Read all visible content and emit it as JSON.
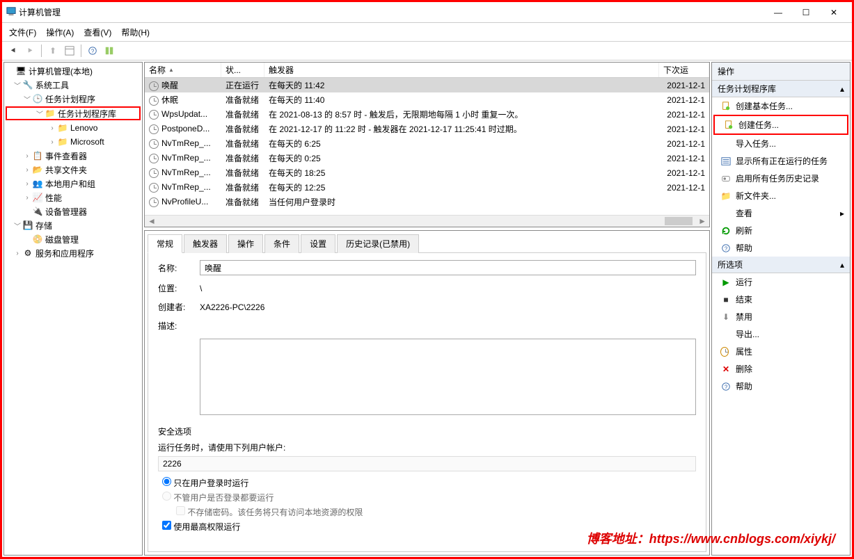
{
  "window": {
    "title": "计算机管理"
  },
  "menu": {
    "file": "文件(F)",
    "action": "操作(A)",
    "view": "查看(V)",
    "help": "帮助(H)"
  },
  "tree": {
    "root": "计算机管理(本地)",
    "systools": "系统工具",
    "tasksched": "任务计划程序",
    "taskslib": "任务计划程序库",
    "lenovo": "Lenovo",
    "microsoft": "Microsoft",
    "eventviewer": "事件查看器",
    "shared": "共享文件夹",
    "users": "本地用户和组",
    "perf": "性能",
    "devmgr": "设备管理器",
    "storage": "存储",
    "diskmgmt": "磁盘管理",
    "services": "服务和应用程序"
  },
  "list": {
    "headers": {
      "name": "名称",
      "status": "状...",
      "trigger": "触发器",
      "next": "下次运"
    },
    "rows": [
      {
        "name": "唤醒",
        "status": "正在运行",
        "trigger": "在每天的 11:42",
        "next": "2021-12-1",
        "selected": true
      },
      {
        "name": "休眠",
        "status": "准备就绪",
        "trigger": "在每天的 11:40",
        "next": "2021-12-1"
      },
      {
        "name": "WpsUpdat...",
        "status": "准备就绪",
        "trigger": "在 2021-08-13 的 8:57 时 - 触发后，无限期地每隔 1 小时 重复一次。",
        "next": "2021-12-1"
      },
      {
        "name": "PostponeD...",
        "status": "准备就绪",
        "trigger": "在 2021-12-17 的 11:22 时 - 触发器在 2021-12-17 11:25:41 时过期。",
        "next": "2021-12-1"
      },
      {
        "name": "NvTmRep_...",
        "status": "准备就绪",
        "trigger": "在每天的 6:25",
        "next": "2021-12-1"
      },
      {
        "name": "NvTmRep_...",
        "status": "准备就绪",
        "trigger": "在每天的 0:25",
        "next": "2021-12-1"
      },
      {
        "name": "NvTmRep_...",
        "status": "准备就绪",
        "trigger": "在每天的 18:25",
        "next": "2021-12-1"
      },
      {
        "name": "NvTmRep_...",
        "status": "准备就绪",
        "trigger": "在每天的 12:25",
        "next": "2021-12-1"
      },
      {
        "name": "NvProfileU...",
        "status": "准备就绪",
        "trigger": "当任何用户登录时",
        "next": ""
      }
    ]
  },
  "tabs": {
    "general": "常规",
    "triggers": "触发器",
    "actions": "操作",
    "conditions": "条件",
    "settings": "设置",
    "history": "历史记录(已禁用)"
  },
  "detail": {
    "name_label": "名称:",
    "name_value": "唤醒",
    "loc_label": "位置:",
    "loc_value": "\\",
    "author_label": "创建者:",
    "author_value": "XA2226-PC\\2226",
    "desc_label": "描述:",
    "sec_legend": "安全选项",
    "sec_useracc_label": "运行任务时，请使用下列用户帐户:",
    "sec_useracc": "2226",
    "sec_radio1": "只在用户登录时运行",
    "sec_radio2": "不管用户是否登录都要运行",
    "sec_chk1": "不存储密码。该任务将只有访问本地资源的权限",
    "sec_chk2": "使用最高权限运行"
  },
  "actionsPane": {
    "header": "操作",
    "group1": "任务计划程序库",
    "items1": [
      {
        "icon": "doc-new",
        "label": "创建基本任务..."
      },
      {
        "icon": "doc-new",
        "label": "创建任务...",
        "highlight": true
      },
      {
        "icon": "blank",
        "label": "导入任务..."
      },
      {
        "icon": "list",
        "label": "显示所有正在运行的任务"
      },
      {
        "icon": "toggle",
        "label": "启用所有任务历史记录"
      },
      {
        "icon": "folder",
        "label": "新文件夹..."
      },
      {
        "icon": "blank",
        "label": "查看",
        "submenu": true
      },
      {
        "icon": "refresh",
        "label": "刷新"
      },
      {
        "icon": "help",
        "label": "帮助"
      }
    ],
    "group2": "所选项",
    "items2": [
      {
        "icon": "play",
        "label": "运行"
      },
      {
        "icon": "stop",
        "label": "结束"
      },
      {
        "icon": "disable",
        "label": "禁用"
      },
      {
        "icon": "blank",
        "label": "导出..."
      },
      {
        "icon": "clock",
        "label": "属性"
      },
      {
        "icon": "delete",
        "label": "删除"
      },
      {
        "icon": "help",
        "label": "帮助"
      }
    ]
  },
  "blog": {
    "label": "博客地址：",
    "url": "https://www.cnblogs.com/xiykj/"
  }
}
